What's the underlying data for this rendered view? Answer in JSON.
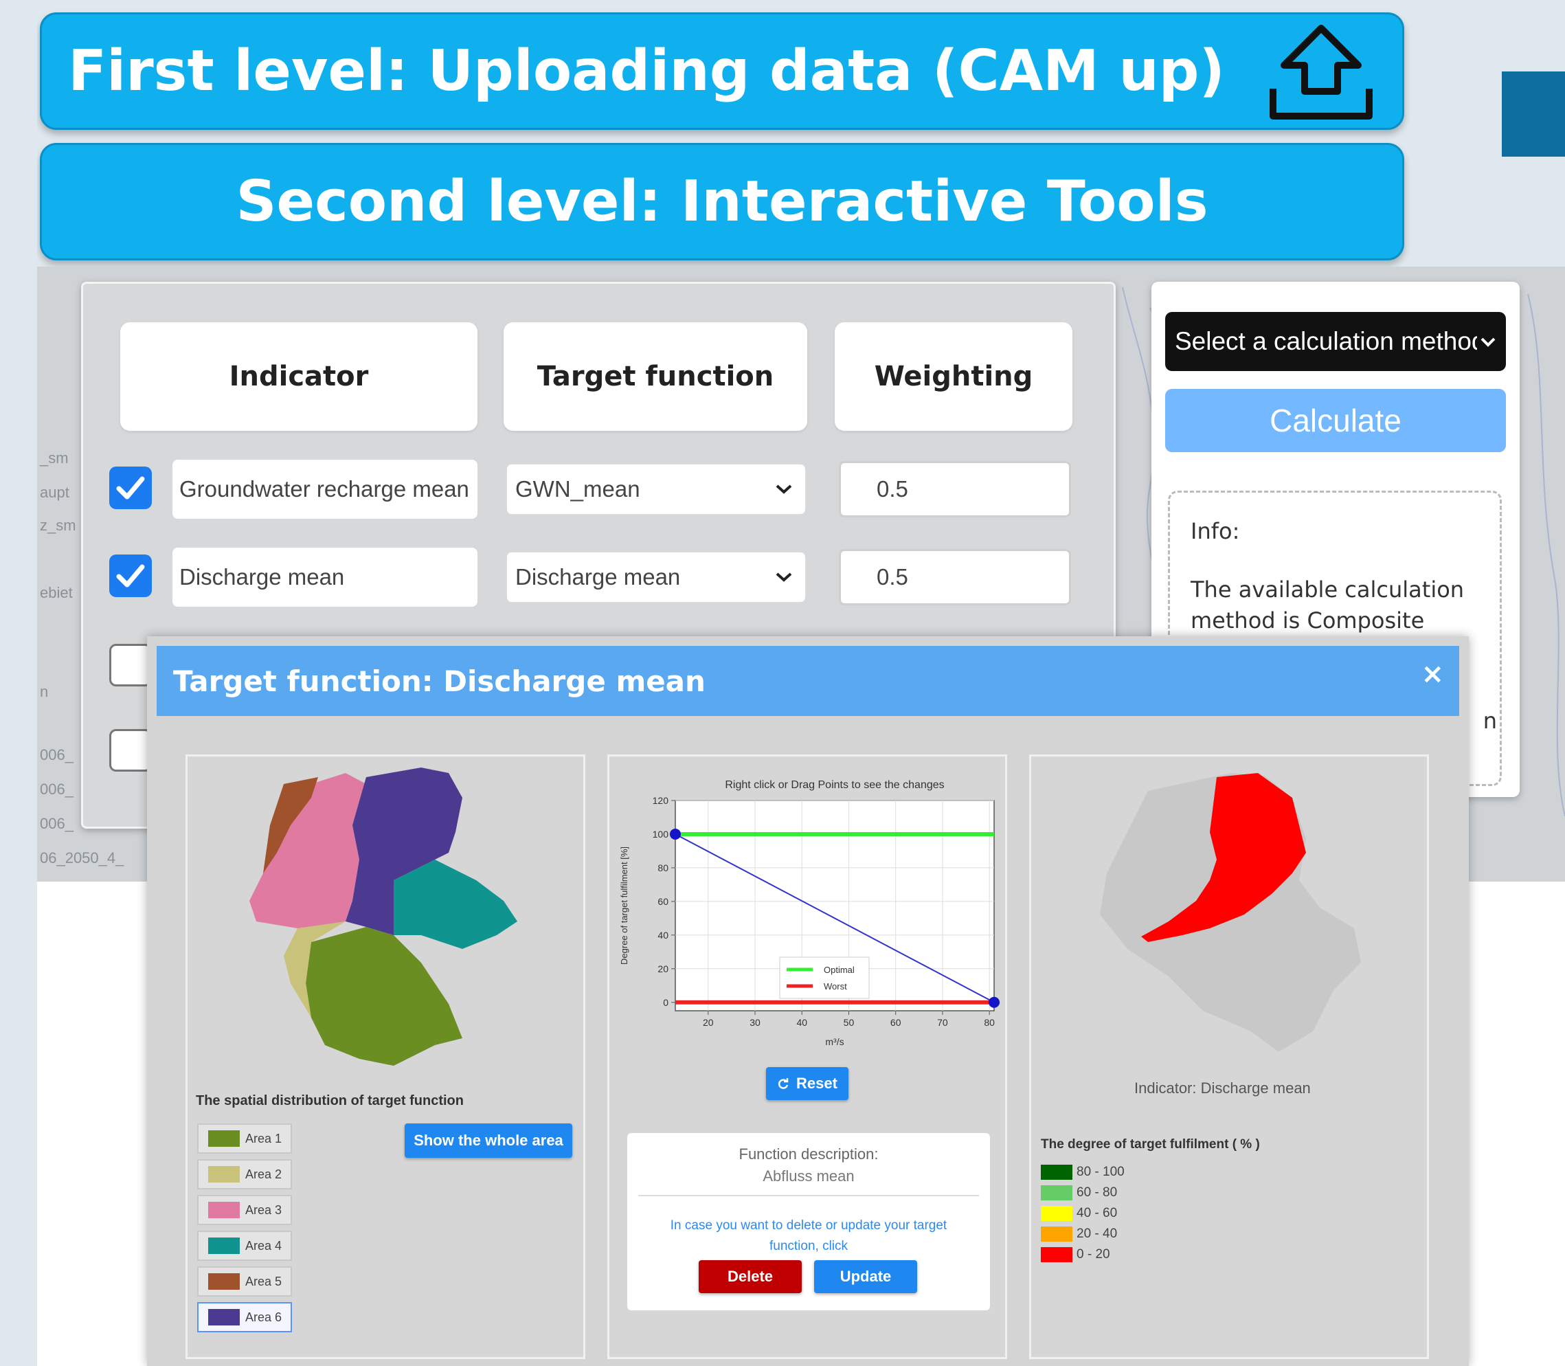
{
  "banners": {
    "first": "First level: Uploading data (CAM up)",
    "second": "Second level: Interactive Tools"
  },
  "map_ghost_labels": [
    "_sm",
    "aupt",
    "z_sm",
    "ebiet",
    "n",
    "006_",
    "006_",
    "006_",
    "06_2050_4_"
  ],
  "table": {
    "headers": {
      "indicator": "Indicator",
      "target": "Target function",
      "weighting": "Weighting"
    },
    "rows": [
      {
        "checked": true,
        "indicator": "Groundwater recharge mean",
        "target": "GWN_mean",
        "weight": "0.5"
      },
      {
        "checked": true,
        "indicator": "Discharge mean",
        "target": "Discharge mean",
        "weight": "0.5"
      },
      {
        "checked": false
      },
      {
        "checked": false
      }
    ]
  },
  "calc": {
    "select_value": "Select a calculation method",
    "button": "Calculate",
    "info_title": "Info:",
    "info_text": "The available calculation method is Composite",
    "info_tail": "n"
  },
  "modal": {
    "title": "Target function: Discharge mean",
    "close": "×",
    "spatial": {
      "caption": "The spatial distribution of target function",
      "areas": [
        {
          "label": "Area 1",
          "color": "#6b8e23"
        },
        {
          "label": "Area 2",
          "color": "#c8c27a"
        },
        {
          "label": "Area 3",
          "color": "#e07aa0"
        },
        {
          "label": "Area 4",
          "color": "#0f9490"
        },
        {
          "label": "Area 5",
          "color": "#a0522d"
        },
        {
          "label": "Area 6",
          "color": "#4b3a8f"
        }
      ],
      "selected_area": "Area 6",
      "show_button": "Show the whole area"
    },
    "chart": {
      "reset": "Reset",
      "reset_icon": "refresh-icon",
      "function_description_title": "Function description:",
      "function_description_value": "Abfluss mean",
      "note": "In case you want to delete or update your target function, click",
      "delete": "Delete",
      "update": "Update"
    },
    "result": {
      "indicator_label": "Indicator:  Discharge mean",
      "legend_title": "The degree of target fulfilment ( % )",
      "legend": [
        {
          "label": "80 - 100",
          "color": "#006400"
        },
        {
          "label": "60 - 80",
          "color": "#66cc66"
        },
        {
          "label": "40 - 60",
          "color": "#ffff00"
        },
        {
          "label": "20 - 40",
          "color": "#ffa500"
        },
        {
          "label": "0 - 20",
          "color": "#ff0000"
        }
      ]
    }
  },
  "chart_data": {
    "type": "line",
    "title": "Right click or Drag Points to see the changes",
    "xlabel": "m³/s",
    "ylabel": "Degree of target fulfilment [%]",
    "xlim": [
      13,
      81
    ],
    "ylim": [
      -5,
      120
    ],
    "xticks": [
      20,
      30,
      40,
      50,
      60,
      70,
      80
    ],
    "yticks": [
      0,
      20,
      40,
      60,
      80,
      100,
      120
    ],
    "grid": true,
    "legend_position": "bottom-center",
    "series": [
      {
        "name": "Optimal",
        "color": "#33ee33",
        "x": [
          13,
          81
        ],
        "y": [
          100,
          100
        ]
      },
      {
        "name": "Worst",
        "color": "#ee2222",
        "x": [
          13,
          81
        ],
        "y": [
          0,
          0
        ]
      },
      {
        "name": "",
        "color": "#3333cc",
        "x": [
          13,
          81
        ],
        "y": [
          100,
          0
        ]
      }
    ]
  }
}
